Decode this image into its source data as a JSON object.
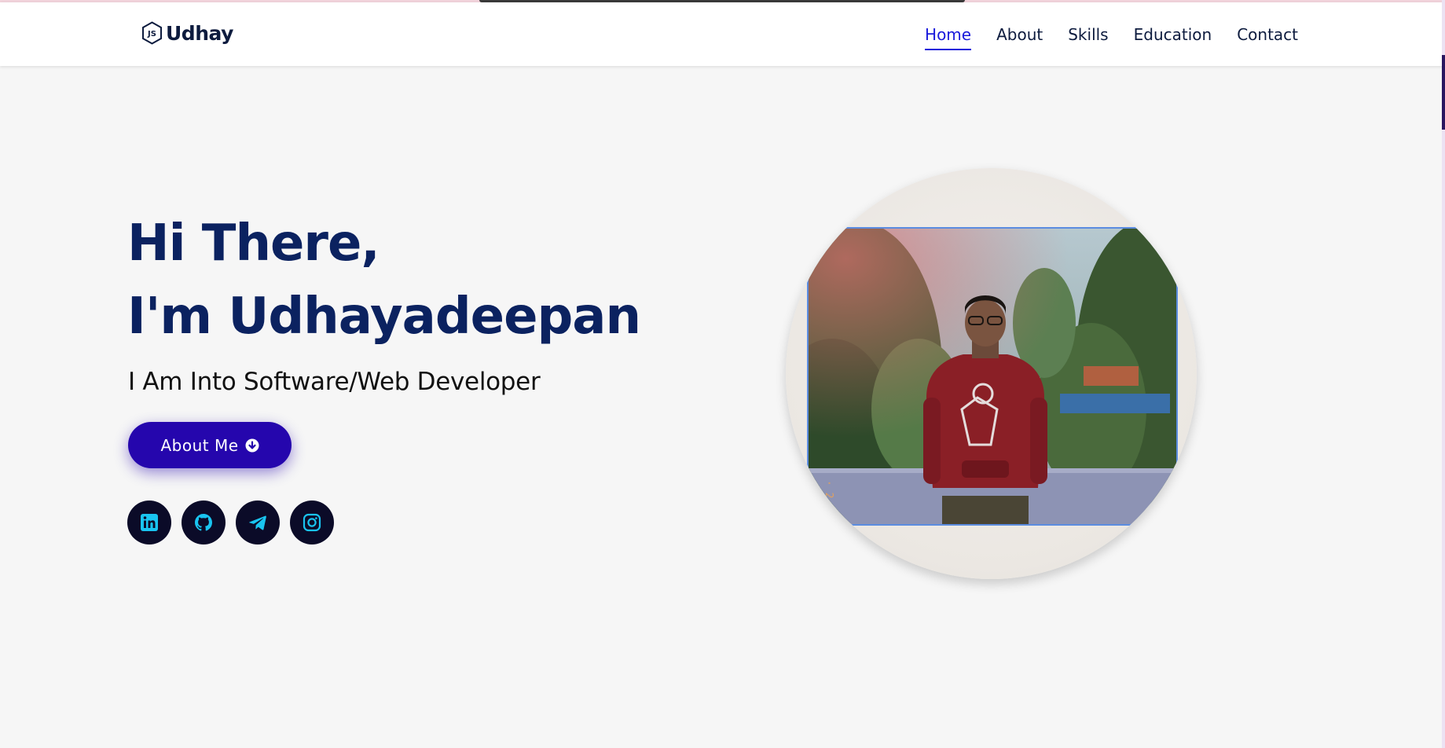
{
  "header": {
    "logo_text": "Udhay",
    "nav": [
      {
        "label": "Home",
        "active": true
      },
      {
        "label": "About",
        "active": false
      },
      {
        "label": "Skills",
        "active": false
      },
      {
        "label": "Education",
        "active": false
      },
      {
        "label": "Contact",
        "active": false
      }
    ]
  },
  "hero": {
    "greeting": "Hi There,",
    "name_line": "I'm Udhayadeepan",
    "subtitle": "I Am Into Software/Web Developer",
    "button_label": "About Me"
  },
  "socials": [
    {
      "icon": "linkedin-icon"
    },
    {
      "icon": "github-icon"
    },
    {
      "icon": "telegram-icon"
    },
    {
      "icon": "instagram-icon"
    }
  ],
  "colors": {
    "accent": "#2506ad",
    "nav_active": "#1a1adb",
    "title": "#0b2260",
    "social_bg": "#0b0b28",
    "social_icon": "#19c4f0"
  }
}
